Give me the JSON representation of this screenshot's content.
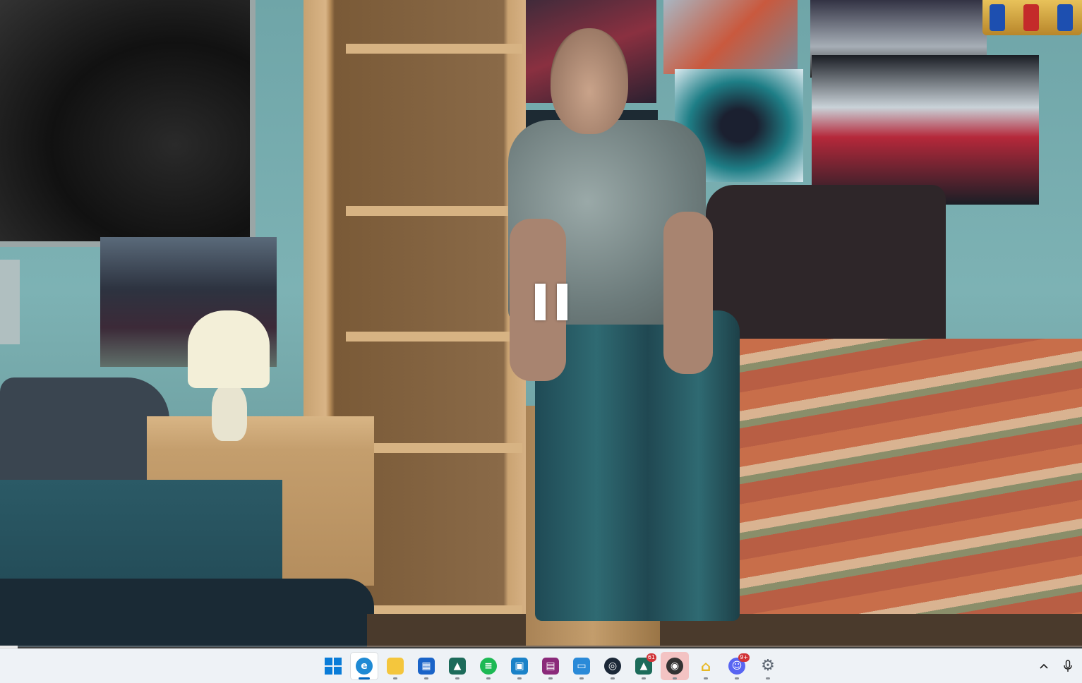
{
  "video": {
    "state": "paused",
    "progress_fraction": 0.016,
    "channel_logo": "TNT"
  },
  "taskbar": {
    "apps": [
      {
        "name": "start",
        "icon": "windows-logo-icon",
        "color": "#0a7cd8",
        "active": false
      },
      {
        "name": "edge",
        "icon": "edge-icon",
        "color": "#1f8ad4",
        "active": true
      },
      {
        "name": "file-explorer",
        "icon": "folder-icon",
        "color": "#f4c63d",
        "active": false
      },
      {
        "name": "microsoft-store",
        "icon": "store-icon",
        "color": "#1a64c8",
        "active": false
      },
      {
        "name": "app-triangle",
        "icon": "triangle-logo-icon",
        "color": "#1c6b5a",
        "active": false
      },
      {
        "name": "spotify",
        "icon": "spotify-icon",
        "color": "#1db954",
        "active": false
      },
      {
        "name": "app-image",
        "icon": "picture-icon",
        "color": "#1a82c8",
        "active": false
      },
      {
        "name": "winrar",
        "icon": "archive-icon",
        "color": "#8b2a7a",
        "active": false
      },
      {
        "name": "app-window",
        "icon": "window-icon",
        "color": "#2a8ad8",
        "active": false
      },
      {
        "name": "steam",
        "icon": "steam-icon",
        "color": "#1b2838",
        "active": false
      },
      {
        "name": "app-badge",
        "icon": "triangle-badge-icon",
        "color": "#1c6b5a",
        "active": false,
        "badge": "61"
      },
      {
        "name": "app-spiral",
        "icon": "spiral-icon",
        "color": "#333333",
        "active": false,
        "highlight": true
      },
      {
        "name": "app-lock",
        "icon": "padlock-icon",
        "color": "#e8b923",
        "active": false
      },
      {
        "name": "discord",
        "icon": "discord-icon",
        "color": "#5865f2",
        "active": false,
        "badge": "9+"
      },
      {
        "name": "settings",
        "icon": "gear-icon",
        "color": "#5a6470",
        "active": false
      }
    ],
    "tray": {
      "overflow_icon": "chevron-up-icon",
      "mic_icon": "microphone-icon"
    }
  }
}
